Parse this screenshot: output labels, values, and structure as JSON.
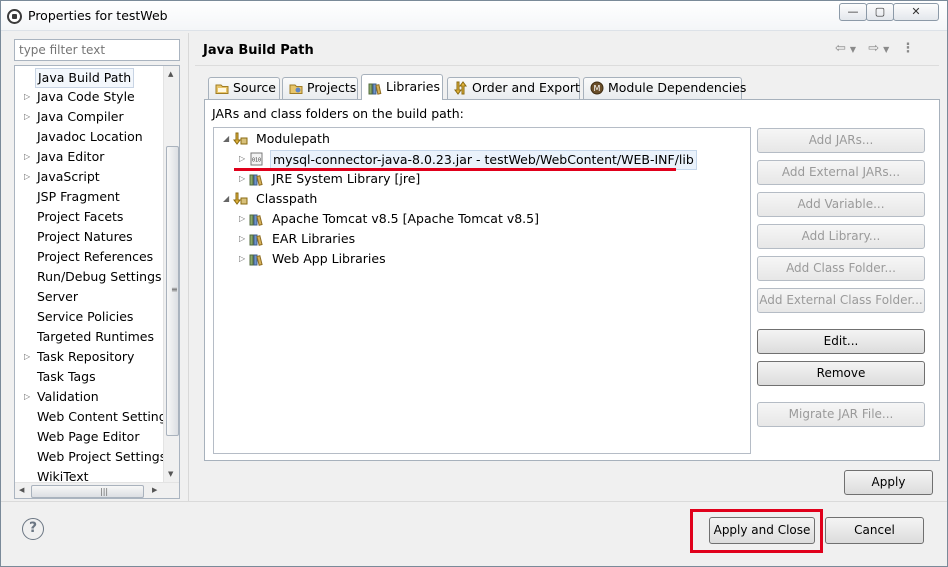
{
  "window": {
    "title": "Properties for testWeb",
    "controls": {
      "minimize": "—",
      "maximize": "▢",
      "close": "✕"
    }
  },
  "filter": {
    "placeholder": "type filter text",
    "value": ""
  },
  "nav": {
    "items": [
      {
        "label": "Java Build Path",
        "expandable": false,
        "selected": true
      },
      {
        "label": "Java Code Style",
        "expandable": true
      },
      {
        "label": "Java Compiler",
        "expandable": true
      },
      {
        "label": "Javadoc Location",
        "expandable": false
      },
      {
        "label": "Java Editor",
        "expandable": true
      },
      {
        "label": "JavaScript",
        "expandable": true
      },
      {
        "label": "JSP Fragment",
        "expandable": false
      },
      {
        "label": "Project Facets",
        "expandable": false
      },
      {
        "label": "Project Natures",
        "expandable": false
      },
      {
        "label": "Project References",
        "expandable": false
      },
      {
        "label": "Run/Debug Settings",
        "expandable": false
      },
      {
        "label": "Server",
        "expandable": false
      },
      {
        "label": "Service Policies",
        "expandable": false
      },
      {
        "label": "Targeted Runtimes",
        "expandable": false
      },
      {
        "label": "Task Repository",
        "expandable": true
      },
      {
        "label": "Task Tags",
        "expandable": false
      },
      {
        "label": "Validation",
        "expandable": true
      },
      {
        "label": "Web Content Settings",
        "expandable": false
      },
      {
        "label": "Web Page Editor",
        "expandable": false
      },
      {
        "label": "Web Project Settings",
        "expandable": false
      },
      {
        "label": "WikiText",
        "expandable": false
      }
    ]
  },
  "page": {
    "title": "Java Build Path",
    "tabs": [
      {
        "label": "Source",
        "icon": "source-folder-icon",
        "active": false
      },
      {
        "label": "Projects",
        "icon": "projects-icon",
        "active": false
      },
      {
        "label": "Libraries",
        "icon": "libraries-icon",
        "active": true
      },
      {
        "label": "Order and Export",
        "icon": "order-export-icon",
        "active": false
      },
      {
        "label": "Module Dependencies",
        "icon": "module-dependencies-icon",
        "active": false
      }
    ],
    "caption": "JARs and class folders on the build path:",
    "tree": [
      {
        "label": "Modulepath",
        "level": 0,
        "expanded": true,
        "icon": "modulepath-icon"
      },
      {
        "label": "mysql-connector-java-8.0.23.jar - testWeb/WebContent/WEB-INF/lib",
        "level": 1,
        "expanded": false,
        "icon": "jar-icon",
        "selected": true
      },
      {
        "label": "JRE System Library [jre]",
        "level": 1,
        "expanded": false,
        "icon": "library-icon"
      },
      {
        "label": "Classpath",
        "level": 0,
        "expanded": true,
        "icon": "classpath-icon"
      },
      {
        "label": "Apache Tomcat v8.5 [Apache Tomcat v8.5]",
        "level": 1,
        "expanded": false,
        "icon": "library-icon"
      },
      {
        "label": "EAR Libraries",
        "level": 1,
        "expanded": false,
        "icon": "library-icon"
      },
      {
        "label": "Web App Libraries",
        "level": 1,
        "expanded": false,
        "icon": "library-icon"
      }
    ],
    "buttons": {
      "add_jars": "Add JARs...",
      "add_external_jars": "Add External JARs...",
      "add_variable": "Add Variable...",
      "add_library": "Add Library...",
      "add_class_folder": "Add Class Folder...",
      "add_external_class_folder": "Add External Class Folder...",
      "edit": "Edit...",
      "remove": "Remove",
      "migrate_jar": "Migrate JAR File..."
    },
    "apply": "Apply"
  },
  "footer": {
    "help": "?",
    "apply_and_close": "Apply and Close",
    "cancel": "Cancel"
  },
  "colors": {
    "annotation_red": "#e0001b",
    "primary_button": "#bee6fd"
  }
}
